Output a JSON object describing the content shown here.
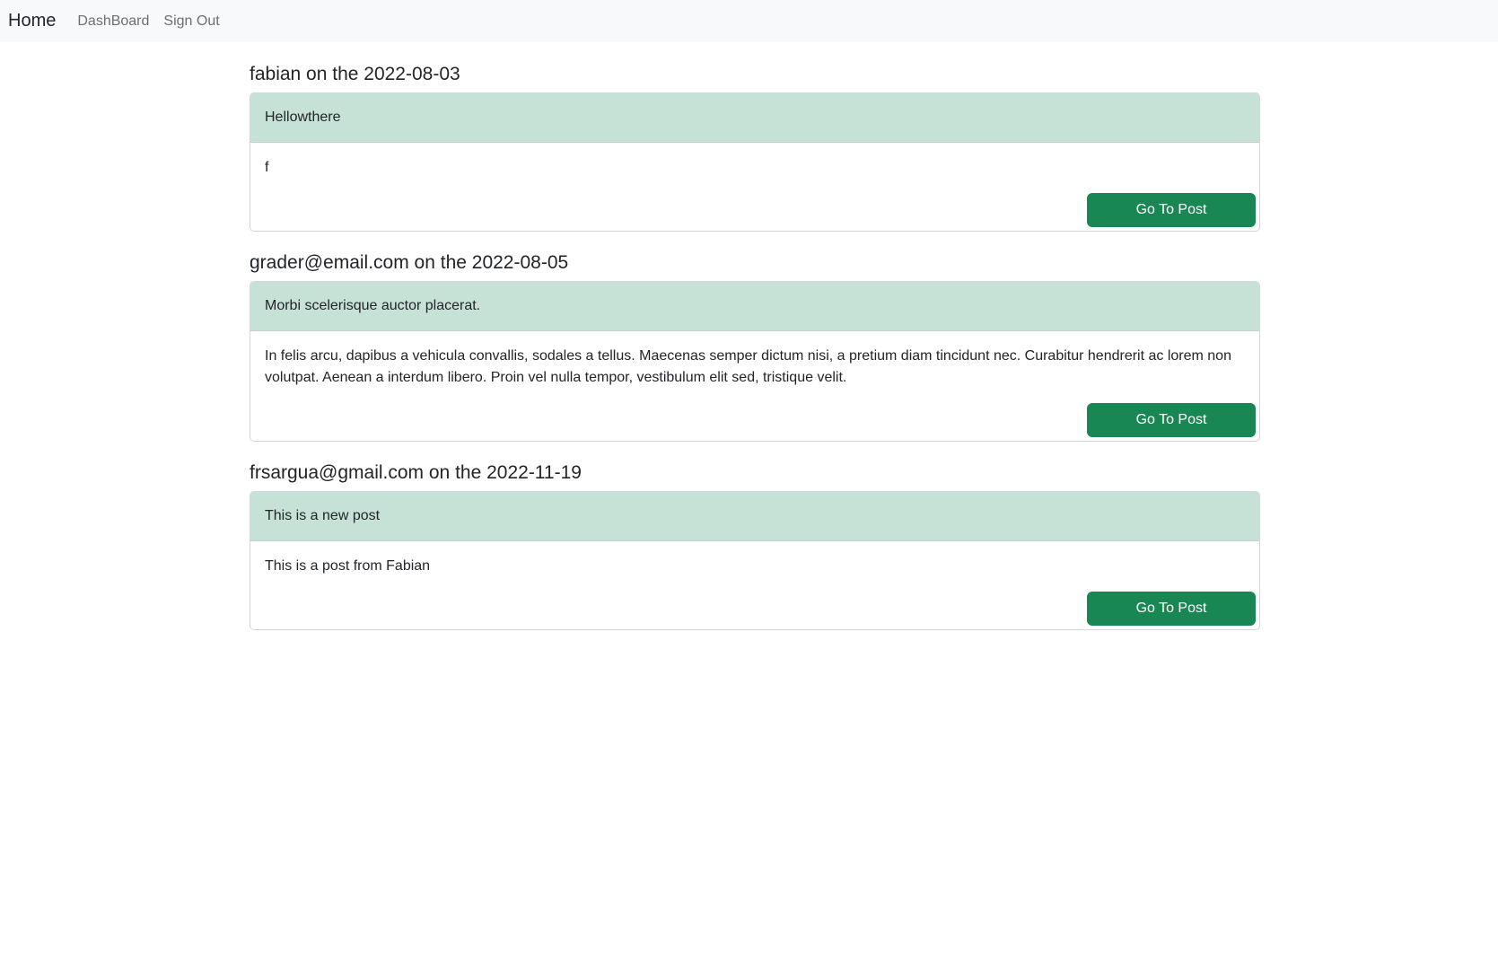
{
  "nav": {
    "brand": "Home",
    "links": [
      "DashBoard",
      "Sign Out"
    ]
  },
  "posts": [
    {
      "heading": "fabian on the 2022-08-03",
      "title": "Hellowthere",
      "body": "f",
      "button": "Go To Post"
    },
    {
      "heading": "grader@email.com on the 2022-08-05",
      "title": "Morbi scelerisque auctor placerat.",
      "body": "In felis arcu, dapibus a vehicula convallis, sodales a tellus. Maecenas semper dictum nisi, a pretium diam tincidunt nec. Curabitur hendrerit ac lorem non volutpat. Aenean a interdum libero. Proin vel nulla tempor, vestibulum elit sed, tristique velit.",
      "button": "Go To Post"
    },
    {
      "heading": "frsargua@gmail.com on the 2022-11-19",
      "title": "This is a new post",
      "body": "This is a post from Fabian",
      "button": "Go To Post"
    }
  ],
  "colors": {
    "navbar_bg": "#f8f9fa",
    "card_header_bg": "#c6e2d6",
    "button_bg": "#198754"
  }
}
